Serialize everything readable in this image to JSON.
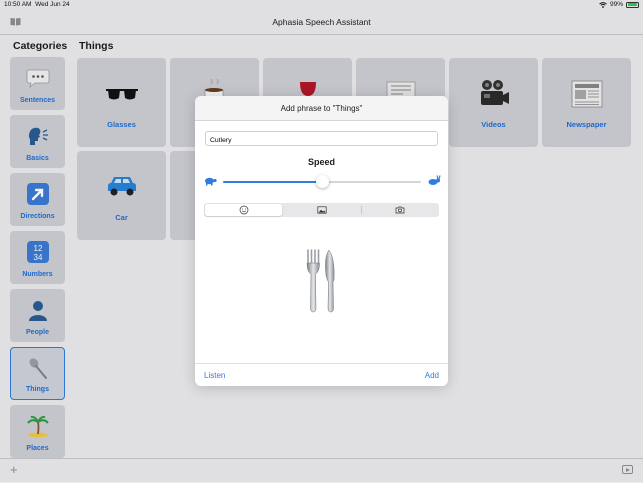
{
  "status_bar": {
    "time": "10:50 AM",
    "date": "Wed Jun 24",
    "battery": "99%",
    "battery_level": 0.99
  },
  "nav": {
    "title": "Aphasia Speech Assistant"
  },
  "sidebar": {
    "title": "Categories",
    "items": [
      {
        "label": "Sentences",
        "icon": "speech-bubble-icon"
      },
      {
        "label": "Basics",
        "icon": "speaking-head-icon"
      },
      {
        "label": "Directions",
        "icon": "arrow-icon"
      },
      {
        "label": "Numbers",
        "icon": "numbers-icon"
      },
      {
        "label": "People",
        "icon": "person-icon"
      },
      {
        "label": "Things",
        "icon": "spoon-icon",
        "selected": true
      },
      {
        "label": "Places",
        "icon": "palm-tree-icon"
      }
    ]
  },
  "main": {
    "title": "Things",
    "tiles": [
      {
        "label": "Glasses",
        "icon": "sunglasses-icon"
      },
      {
        "label": "",
        "icon": "coffee-icon"
      },
      {
        "label": "",
        "icon": "wine-icon"
      },
      {
        "label": "",
        "icon": "newspaper-icon"
      },
      {
        "label": "Videos",
        "icon": "movie-camera-icon"
      },
      {
        "label": "Newspaper",
        "icon": "newspaper-icon"
      },
      {
        "label": "Car",
        "icon": "car-icon"
      },
      {
        "label": "",
        "icon": ""
      }
    ]
  },
  "modal": {
    "title": "Add phrase to \"Things\"",
    "input_value": "Cutlery",
    "speed_label": "Speed",
    "speed_value": 0.5,
    "segments": [
      {
        "icon": "smiley-icon",
        "active": true
      },
      {
        "icon": "photo-icon",
        "active": false
      },
      {
        "icon": "camera-icon",
        "active": false
      }
    ],
    "image_icon": "fork-and-knife-icon",
    "listen_label": "Listen",
    "add_label": "Add"
  },
  "colors": {
    "accent": "#2f7de1",
    "background": "#ececef",
    "tile": "#cfd0d6"
  }
}
